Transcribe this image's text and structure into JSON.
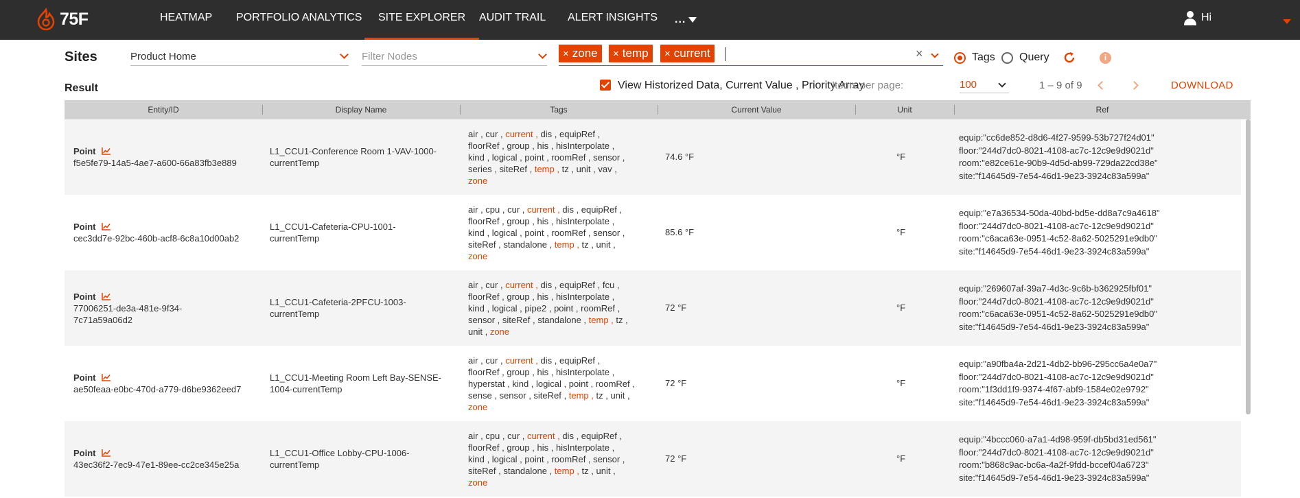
{
  "brand": {
    "logo_text": "75F",
    "accent": "#e24301"
  },
  "nav": {
    "items": [
      {
        "label": "HEATMAP"
      },
      {
        "label": "PORTFOLIO ANALYTICS"
      },
      {
        "label": "SITE EXPLORER",
        "active": true
      },
      {
        "label": "AUDIT TRAIL"
      },
      {
        "label": "ALERT INSIGHTS"
      },
      {
        "label": "..."
      }
    ],
    "user_greeting": "Hi"
  },
  "filters": {
    "title": "Sites",
    "site_value": "Product Home",
    "nodes_placeholder": "Filter Nodes",
    "chips": [
      "zone",
      "temp",
      "current"
    ],
    "chip_remove": "×",
    "clear_symbol": "×",
    "mode_tags": "Tags",
    "mode_query": "Query",
    "selected_mode": "Tags",
    "info_symbol": "i"
  },
  "result": {
    "title": "Result",
    "historized_label": "View Historized Data, Current Value , Priority Array",
    "items_per_page_label": "Items per page:",
    "items_per_page_value": "100",
    "range": "1 – 9 of 9",
    "download": "DOWNLOAD"
  },
  "table": {
    "columns": [
      "Entity/ID",
      "Display Name",
      "Tags",
      "Current Value",
      "Unit",
      "Ref"
    ],
    "rows": [
      {
        "type": "Point",
        "id": "f5e5fe79-14a5-4ae7-a600-66a83fb3e889",
        "display_lines": [
          "L1_CCU1-Conference Room 1-VAV-1000-",
          "currentTemp"
        ],
        "tag_lines": [
          [
            "air",
            "cur",
            "current",
            "dis",
            "equipRef"
          ],
          [
            "floorRef",
            "group",
            "his",
            "hisInterpolate"
          ],
          [
            "kind",
            "logical",
            "point",
            "roomRef",
            "sensor"
          ],
          [
            "series",
            "siteRef",
            "temp",
            "tz",
            "unit",
            "vav"
          ],
          [
            "zone"
          ]
        ],
        "value": "74.6 °F",
        "unit": "°F",
        "refs": [
          "equip:\"cc6de852-d8d6-4f27-9599-53b727f24d01\"",
          "floor:\"244d7dc0-8021-4108-ac7c-12c9e9d9021d\"",
          "room:\"e82ce61e-90b9-4d5d-ab99-729da22cd38e\"",
          "site:\"f14645d9-7e54-46d1-9e23-3924c83a599a\""
        ]
      },
      {
        "type": "Point",
        "id": "cec3dd7e-92bc-460b-acf8-6c8a10d00ab2",
        "display_lines": [
          "L1_CCU1-Cafeteria-CPU-1001-",
          "currentTemp"
        ],
        "tag_lines": [
          [
            "air",
            "cpu",
            "cur",
            "current",
            "dis",
            "equipRef"
          ],
          [
            "floorRef",
            "group",
            "his",
            "hisInterpolate"
          ],
          [
            "kind",
            "logical",
            "point",
            "roomRef",
            "sensor"
          ],
          [
            "siteRef",
            "standalone",
            "temp",
            "tz",
            "unit"
          ],
          [
            "zone"
          ]
        ],
        "value": "85.6 °F",
        "unit": "°F",
        "refs": [
          "equip:\"e7a36534-50da-40bd-bd5e-dd8a7c9a4618\"",
          "floor:\"244d7dc0-8021-4108-ac7c-12c9e9d9021d\"",
          "room:\"c6aca63e-0951-4c52-8a62-5025291e9db0\"",
          "site:\"f14645d9-7e54-46d1-9e23-3924c83a599a\""
        ]
      },
      {
        "type": "Point",
        "id_lines": [
          "77006251-de3a-481e-9f34-",
          "7c71a59a06d2"
        ],
        "display_lines": [
          "L1_CCU1-Cafeteria-2PFCU-1003-",
          "currentTemp"
        ],
        "tag_lines": [
          [
            "air",
            "cur",
            "current",
            "dis",
            "equipRef",
            "fcu"
          ],
          [
            "floorRef",
            "group",
            "his",
            "hisInterpolate"
          ],
          [
            "kind",
            "logical",
            "pipe2",
            "point",
            "roomRef"
          ],
          [
            "sensor",
            "siteRef",
            "standalone",
            "temp",
            "tz"
          ],
          [
            "unit",
            "zone"
          ]
        ],
        "value": "72 °F",
        "unit": "°F",
        "refs": [
          "equip:\"269607af-39a7-4d3c-9c6b-b362925fbf01\"",
          "floor:\"244d7dc0-8021-4108-ac7c-12c9e9d9021d\"",
          "room:\"c6aca63e-0951-4c52-8a62-5025291e9db0\"",
          "site:\"f14645d9-7e54-46d1-9e23-3924c83a599a\""
        ]
      },
      {
        "type": "Point",
        "id": "ae50feaa-e0bc-470d-a779-d6be9362eed7",
        "display_lines": [
          "L1_CCU1-Meeting Room Left Bay-SENSE-",
          "1004-currentTemp"
        ],
        "tag_lines": [
          [
            "air",
            "cur",
            "current",
            "dis",
            "equipRef"
          ],
          [
            "floorRef",
            "group",
            "his",
            "hisInterpolate"
          ],
          [
            "hyperstat",
            "kind",
            "logical",
            "point",
            "roomRef"
          ],
          [
            "sense",
            "sensor",
            "siteRef",
            "temp",
            "tz",
            "unit"
          ],
          [
            "zone"
          ]
        ],
        "value": "72 °F",
        "unit": "°F",
        "refs": [
          "equip:\"a90fba4a-2d21-4db2-bb96-295cc6a4e0a7\"",
          "floor:\"244d7dc0-8021-4108-ac7c-12c9e9d9021d\"",
          "room:\"1f3dd1f9-9374-4f67-abf9-1584e02e9792\"",
          "site:\"f14645d9-7e54-46d1-9e23-3924c83a599a\""
        ]
      },
      {
        "type": "Point",
        "id": "43ec36f2-7ec9-47e1-89ee-cc2ce345e25a",
        "display_lines": [
          "L1_CCU1-Office Lobby-CPU-1006-",
          "currentTemp"
        ],
        "tag_lines": [
          [
            "air",
            "cpu",
            "cur",
            "current",
            "dis",
            "equipRef"
          ],
          [
            "floorRef",
            "group",
            "his",
            "hisInterpolate"
          ],
          [
            "kind",
            "logical",
            "point",
            "roomRef",
            "sensor"
          ],
          [
            "siteRef",
            "standalone",
            "temp",
            "tz",
            "unit"
          ],
          [
            "zone"
          ]
        ],
        "value": "72 °F",
        "unit": "°F",
        "refs": [
          "equip:\"4bccc060-a7a1-4d98-959f-db5bd31ed561\"",
          "floor:\"244d7dc0-8021-4108-ac7c-12c9e9d9021d\"",
          "room:\"b868c9ac-bc6a-4a2f-9fdd-bccef04a6723\"",
          "site:\"f14645d9-7e54-46d1-9e23-3924c83a599a\""
        ]
      }
    ]
  }
}
